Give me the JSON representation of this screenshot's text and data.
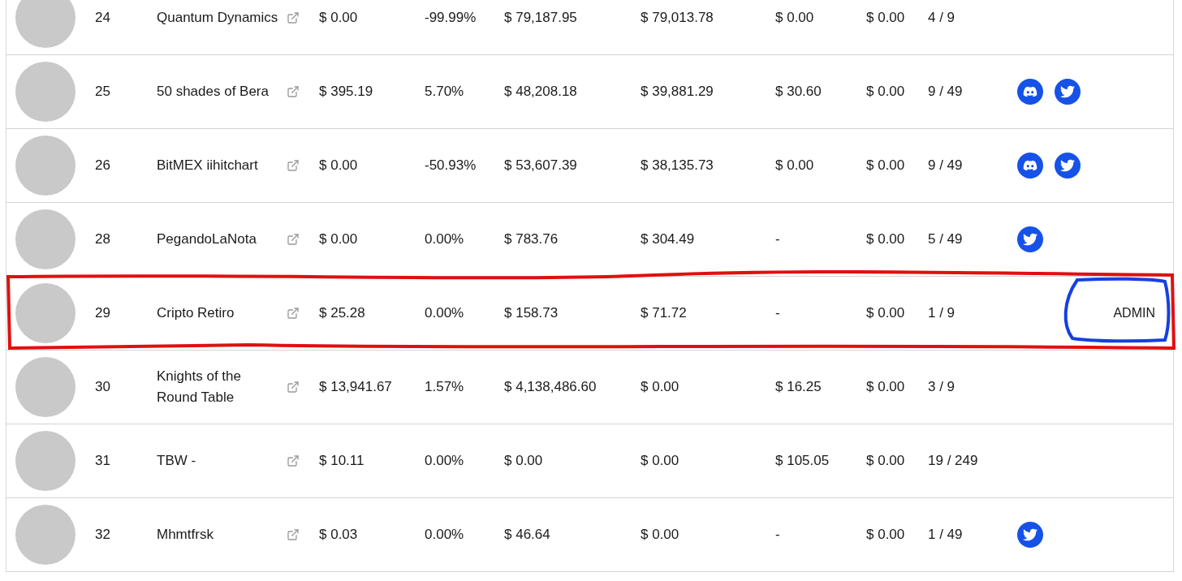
{
  "rows": [
    {
      "rank": "24",
      "name": "Quantum Dynamics",
      "col3": "$ 0.00",
      "col4": "-99.99%",
      "col5": "$ 79,187.95",
      "col6": "$ 79,013.78",
      "col7": "$ 0.00",
      "col8": "$ 0.00",
      "col9": "4 / 9",
      "socials": [],
      "highlighted": false
    },
    {
      "rank": "25",
      "name": "50 shades of Bera",
      "col3": "$ 395.19",
      "col4": "5.70%",
      "col5": "$ 48,208.18",
      "col6": "$ 39,881.29",
      "col7": "$ 30.60",
      "col8": "$ 0.00",
      "col9": "9 / 49",
      "socials": [
        {
          "kind": "discord"
        },
        {
          "kind": "twitter"
        }
      ],
      "highlighted": false
    },
    {
      "rank": "26",
      "name": "BitMEX iihitchart",
      "col3": "$ 0.00",
      "col4": "-50.93%",
      "col5": "$ 53,607.39",
      "col6": "$ 38,135.73",
      "col7": "$ 0.00",
      "col8": "$ 0.00",
      "col9": "9 / 49",
      "socials": [
        {
          "kind": "discord"
        },
        {
          "kind": "twitter"
        }
      ],
      "highlighted": false
    },
    {
      "rank": "28",
      "name": "PegandoLaNota",
      "col3": "$ 0.00",
      "col4": "0.00%",
      "col5": "$ 783.76",
      "col6": "$ 304.49",
      "col7": "-",
      "col8": "$ 0.00",
      "col9": "5 / 49",
      "socials": [
        {
          "kind": "twitter"
        }
      ],
      "highlighted": false
    },
    {
      "rank": "29",
      "name": "Cripto Retiro",
      "col3": "$ 25.28",
      "col4": "0.00%",
      "col5": "$ 158.73",
      "col6": "$ 71.72",
      "col7": "-",
      "col8": "$ 0.00",
      "col9": "1 / 9",
      "socials": [],
      "admin": {
        "label": "ADMIN",
        "circled": true
      },
      "highlighted": true
    },
    {
      "rank": "30",
      "name": "Knights of the Round Table",
      "col3": "$ 13,941.67",
      "col4": "1.57%",
      "col5": "$ 4,138,486.60",
      "col6": "$ 0.00",
      "col7": "$ 16.25",
      "col8": "$ 0.00",
      "col9": "3 / 9",
      "socials": [],
      "highlighted": false
    },
    {
      "rank": "31",
      "name": "TBW -",
      "col3": "$ 10.11",
      "col4": "0.00%",
      "col5": "$ 0.00",
      "col6": "$ 0.00",
      "col7": "$ 105.05",
      "col8": "$ 0.00",
      "col9": "19 / 249",
      "socials": [],
      "highlighted": false
    },
    {
      "rank": "32",
      "name": "Mhmtfrsk",
      "col3": "$ 0.03",
      "col4": "0.00%",
      "col5": "$ 46.64",
      "col6": "$ 0.00",
      "col7": "-",
      "col8": "$ 0.00",
      "col9": "1 / 49",
      "socials": [
        {
          "kind": "twitter"
        }
      ],
      "highlighted": false
    }
  ]
}
